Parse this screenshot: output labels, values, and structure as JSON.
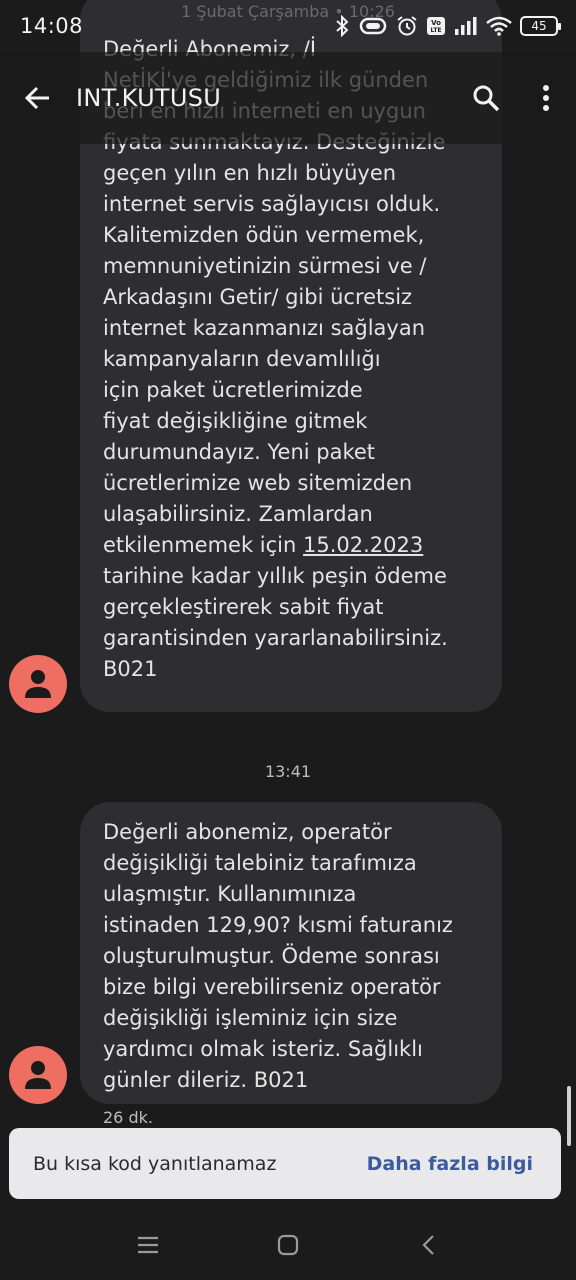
{
  "status_bar": {
    "time": "14:08",
    "battery": "45",
    "icons": [
      "bluetooth-icon",
      "vibrate-icon",
      "alarm-icon",
      "volte-icon",
      "signal-icon",
      "wifi-icon",
      "battery-icon"
    ]
  },
  "app_bar": {
    "title": "INT.KUTUSU",
    "back_icon": "arrow-left-icon",
    "search_icon": "search-icon",
    "more_icon": "more-vert-icon"
  },
  "conversation": {
    "ghost_date": "1 Şubat Çarşamba • 10:26",
    "message_1": {
      "text": "Değerli Abonemiz, /İ\nNetİKİ'ye geldiğimiz ilk günden\nberi en hızlı interneti en uygun\nfiyata sunmaktayız. Desteğinizle\ngeçen yılın en hızlı büyüyen\ninternet servis sağlayıcısı olduk.\nKalitemizden ödün vermemek,\nmemnuniyetinizin sürmesi ve /\nArkadaşını Getir/ gibi ücretsiz\ninternet kazanmanızı sağlayan\nkampanyaların devamlılığı\niçin paket ücretlerimizde\nfiyat değişikliğine gitmek\ndurumundayız. Yeni paket\nücretlerimize web sitemizden\nulaşabilirsiniz. Zamlardan\netkilenmemek için ",
      "date_link": "15.02.2023",
      "text_after": "\ntarihine kadar yıllık peşin ödeme\ngerçekleştirerek sabit fiyat\ngarantisinden yararlanabilirsiniz.\nB021"
    },
    "timestamp": "13:41",
    "message_2": {
      "text": "Değerli abonemiz, operatör\ndeğişikliği talebiniz tarafımıza\nulaşmıştır. Kullanımınıza\nistinaden 129,90? kısmi faturanız\noluşturulmuştur. Ödeme sonrası\nbize bilgi verebilirseniz operatör\ndeğişikliği işleminiz için size\nyardımcı olmak isteriz. Sağlıklı\ngünler dileriz. B021"
    },
    "sent_time": "26 dk."
  },
  "snackbar": {
    "message": "Bu kısa kod yanıtlanamaz",
    "action": "Daha fazla bilgi"
  },
  "nav_bar": {
    "icons": [
      "recents-icon",
      "home-icon",
      "back-nav-icon"
    ]
  },
  "colors": {
    "background": "#1b1b1b",
    "bubble": "#2e2e30",
    "avatar": "#ee6e62",
    "snackbar": "#e9e9ec",
    "action": "#3d5a9c"
  }
}
